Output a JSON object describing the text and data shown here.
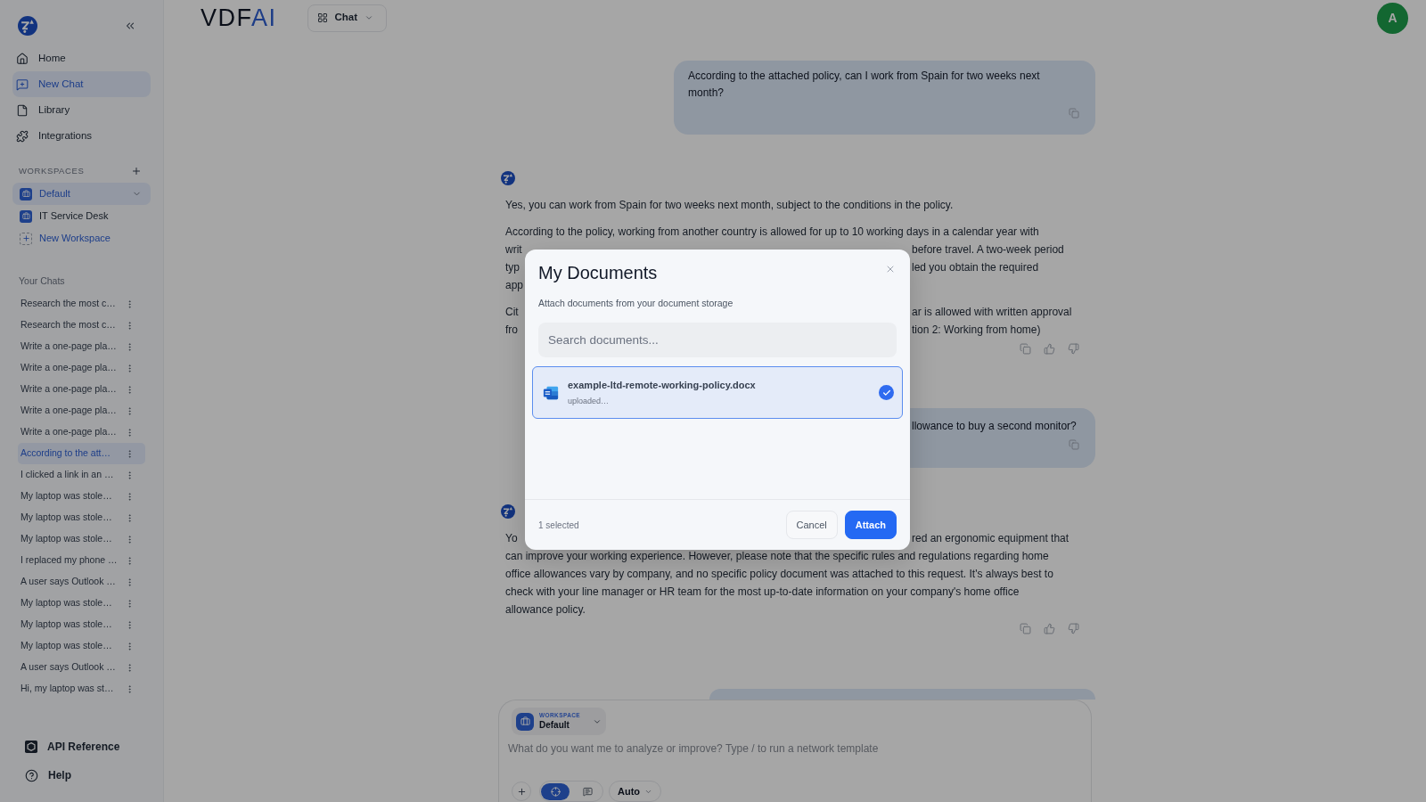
{
  "sidebar": {
    "nav": [
      {
        "label": "Home",
        "selected": false
      },
      {
        "label": "New Chat",
        "selected": true
      },
      {
        "label": "Library",
        "selected": false
      },
      {
        "label": "Integrations",
        "selected": false
      }
    ],
    "workspaces_heading": "WORKSPACES",
    "workspaces": [
      {
        "label": "Default",
        "selected": true
      },
      {
        "label": "IT Service Desk",
        "selected": false
      }
    ],
    "new_workspace": "New Workspace",
    "chats_heading": "Your Chats",
    "chats": [
      {
        "title": "Research the most c…",
        "selected": false
      },
      {
        "title": "Research the most c…",
        "selected": false
      },
      {
        "title": "Write a one-page pla…",
        "selected": false
      },
      {
        "title": "Write a one-page pla…",
        "selected": false
      },
      {
        "title": "Write a one-page pla…",
        "selected": false
      },
      {
        "title": "Write a one-page pla…",
        "selected": false
      },
      {
        "title": "Write a one-page pla…",
        "selected": false
      },
      {
        "title": "According to the att…",
        "selected": true
      },
      {
        "title": "I clicked a link in an …",
        "selected": false
      },
      {
        "title": "My laptop was stole…",
        "selected": false
      },
      {
        "title": "My laptop was stole…",
        "selected": false
      },
      {
        "title": "My laptop was stole…",
        "selected": false
      },
      {
        "title": "I replaced my phone …",
        "selected": false
      },
      {
        "title": "A user says Outlook …",
        "selected": false
      },
      {
        "title": "My laptop was stole…",
        "selected": false
      },
      {
        "title": "My laptop was stole…",
        "selected": false
      },
      {
        "title": "My laptop was stole…",
        "selected": false
      },
      {
        "title": "A user says Outlook …",
        "selected": false
      },
      {
        "title": "Hi, my laptop was st…",
        "selected": false
      }
    ],
    "footer": [
      {
        "label": "API Reference"
      },
      {
        "label": "Help"
      }
    ]
  },
  "header": {
    "logo": {
      "text": "VDF",
      "accent": "AI"
    },
    "mode": "Chat",
    "avatar": "A"
  },
  "messages": [
    {
      "kind": "user",
      "text": "According to the attached policy, can I work from Spain for two weeks next month?"
    },
    {
      "kind": "assistant",
      "paragraphs": [
        [
          "Yes, you can work from Spain for two weeks next month, subject to the conditions in the policy."
        ],
        [
          "According to the policy, working from another country is allowed for up to 10 working days in a calendar year with",
          {
            "left_of_dialog": "writ",
            "right_of_dialog": "before travel. A two-week period"
          },
          {
            "left_of_dialog": "typ",
            "right_of_dialog": "led you obtain the required"
          },
          {
            "left_of_dialog": "app"
          }
        ],
        [
          {
            "left_of_dialog": "Cit",
            "right_of_dialog": "ar is allowed with written approval"
          },
          {
            "left_of_dialog": "fro",
            "right_of_dialog": "tion 2: Working from home)"
          }
        ]
      ]
    },
    {
      "kind": "user",
      "lines": [
        {
          "right_of_dialog": "llowance to buy a second monitor?"
        }
      ]
    },
    {
      "kind": "assistant",
      "paragraphs": [
        [
          {
            "left_of_dialog": "Yo",
            "right_of_dialog": "red an ergonomic equipment that"
          },
          "can improve your working experience. However, please note that the specific rules and regulations regarding home",
          "office allowances vary by company, and no specific policy document was attached to this request. It's always best to",
          "check with your line manager or HR team for the most up-to-date information on your company's home office",
          "allowance policy."
        ]
      ]
    }
  ],
  "composer": {
    "workspace_label": "WORKSPACE",
    "workspace": "Default",
    "placeholder": "What do you want me to analyze or improve? Type / to run a network template",
    "modes": [
      {
        "kind": "target",
        "selected": true
      },
      {
        "kind": "chat",
        "selected": false
      }
    ],
    "model": "Auto"
  },
  "dialog": {
    "title": "My Documents",
    "subtitle": "Attach documents from your document storage",
    "search_placeholder": "Search documents...",
    "documents": [
      {
        "name": "example-ltd-remote-working-policy.docx",
        "status": "uploaded…",
        "selected": true
      }
    ],
    "selection_count": "1 selected",
    "buttons": [
      {
        "label": "Cancel",
        "kind": "secondary"
      },
      {
        "label": "Attach",
        "kind": "primary"
      }
    ]
  }
}
